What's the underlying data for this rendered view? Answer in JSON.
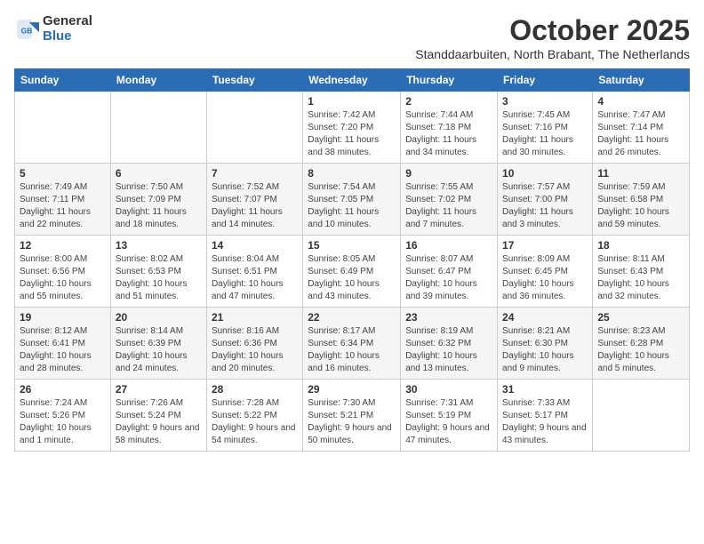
{
  "logo": {
    "general": "General",
    "blue": "Blue"
  },
  "header": {
    "month_title": "October 2025",
    "subtitle": "Standdaarbuiten, North Brabant, The Netherlands"
  },
  "days_of_week": [
    "Sunday",
    "Monday",
    "Tuesday",
    "Wednesday",
    "Thursday",
    "Friday",
    "Saturday"
  ],
  "weeks": [
    [
      {
        "day": "",
        "info": ""
      },
      {
        "day": "",
        "info": ""
      },
      {
        "day": "",
        "info": ""
      },
      {
        "day": "1",
        "info": "Sunrise: 7:42 AM\nSunset: 7:20 PM\nDaylight: 11 hours and 38 minutes."
      },
      {
        "day": "2",
        "info": "Sunrise: 7:44 AM\nSunset: 7:18 PM\nDaylight: 11 hours and 34 minutes."
      },
      {
        "day": "3",
        "info": "Sunrise: 7:45 AM\nSunset: 7:16 PM\nDaylight: 11 hours and 30 minutes."
      },
      {
        "day": "4",
        "info": "Sunrise: 7:47 AM\nSunset: 7:14 PM\nDaylight: 11 hours and 26 minutes."
      }
    ],
    [
      {
        "day": "5",
        "info": "Sunrise: 7:49 AM\nSunset: 7:11 PM\nDaylight: 11 hours and 22 minutes."
      },
      {
        "day": "6",
        "info": "Sunrise: 7:50 AM\nSunset: 7:09 PM\nDaylight: 11 hours and 18 minutes."
      },
      {
        "day": "7",
        "info": "Sunrise: 7:52 AM\nSunset: 7:07 PM\nDaylight: 11 hours and 14 minutes."
      },
      {
        "day": "8",
        "info": "Sunrise: 7:54 AM\nSunset: 7:05 PM\nDaylight: 11 hours and 10 minutes."
      },
      {
        "day": "9",
        "info": "Sunrise: 7:55 AM\nSunset: 7:02 PM\nDaylight: 11 hours and 7 minutes."
      },
      {
        "day": "10",
        "info": "Sunrise: 7:57 AM\nSunset: 7:00 PM\nDaylight: 11 hours and 3 minutes."
      },
      {
        "day": "11",
        "info": "Sunrise: 7:59 AM\nSunset: 6:58 PM\nDaylight: 10 hours and 59 minutes."
      }
    ],
    [
      {
        "day": "12",
        "info": "Sunrise: 8:00 AM\nSunset: 6:56 PM\nDaylight: 10 hours and 55 minutes."
      },
      {
        "day": "13",
        "info": "Sunrise: 8:02 AM\nSunset: 6:53 PM\nDaylight: 10 hours and 51 minutes."
      },
      {
        "day": "14",
        "info": "Sunrise: 8:04 AM\nSunset: 6:51 PM\nDaylight: 10 hours and 47 minutes."
      },
      {
        "day": "15",
        "info": "Sunrise: 8:05 AM\nSunset: 6:49 PM\nDaylight: 10 hours and 43 minutes."
      },
      {
        "day": "16",
        "info": "Sunrise: 8:07 AM\nSunset: 6:47 PM\nDaylight: 10 hours and 39 minutes."
      },
      {
        "day": "17",
        "info": "Sunrise: 8:09 AM\nSunset: 6:45 PM\nDaylight: 10 hours and 36 minutes."
      },
      {
        "day": "18",
        "info": "Sunrise: 8:11 AM\nSunset: 6:43 PM\nDaylight: 10 hours and 32 minutes."
      }
    ],
    [
      {
        "day": "19",
        "info": "Sunrise: 8:12 AM\nSunset: 6:41 PM\nDaylight: 10 hours and 28 minutes."
      },
      {
        "day": "20",
        "info": "Sunrise: 8:14 AM\nSunset: 6:39 PM\nDaylight: 10 hours and 24 minutes."
      },
      {
        "day": "21",
        "info": "Sunrise: 8:16 AM\nSunset: 6:36 PM\nDaylight: 10 hours and 20 minutes."
      },
      {
        "day": "22",
        "info": "Sunrise: 8:17 AM\nSunset: 6:34 PM\nDaylight: 10 hours and 16 minutes."
      },
      {
        "day": "23",
        "info": "Sunrise: 8:19 AM\nSunset: 6:32 PM\nDaylight: 10 hours and 13 minutes."
      },
      {
        "day": "24",
        "info": "Sunrise: 8:21 AM\nSunset: 6:30 PM\nDaylight: 10 hours and 9 minutes."
      },
      {
        "day": "25",
        "info": "Sunrise: 8:23 AM\nSunset: 6:28 PM\nDaylight: 10 hours and 5 minutes."
      }
    ],
    [
      {
        "day": "26",
        "info": "Sunrise: 7:24 AM\nSunset: 5:26 PM\nDaylight: 10 hours and 1 minute."
      },
      {
        "day": "27",
        "info": "Sunrise: 7:26 AM\nSunset: 5:24 PM\nDaylight: 9 hours and 58 minutes."
      },
      {
        "day": "28",
        "info": "Sunrise: 7:28 AM\nSunset: 5:22 PM\nDaylight: 9 hours and 54 minutes."
      },
      {
        "day": "29",
        "info": "Sunrise: 7:30 AM\nSunset: 5:21 PM\nDaylight: 9 hours and 50 minutes."
      },
      {
        "day": "30",
        "info": "Sunrise: 7:31 AM\nSunset: 5:19 PM\nDaylight: 9 hours and 47 minutes."
      },
      {
        "day": "31",
        "info": "Sunrise: 7:33 AM\nSunset: 5:17 PM\nDaylight: 9 hours and 43 minutes."
      },
      {
        "day": "",
        "info": ""
      }
    ]
  ]
}
